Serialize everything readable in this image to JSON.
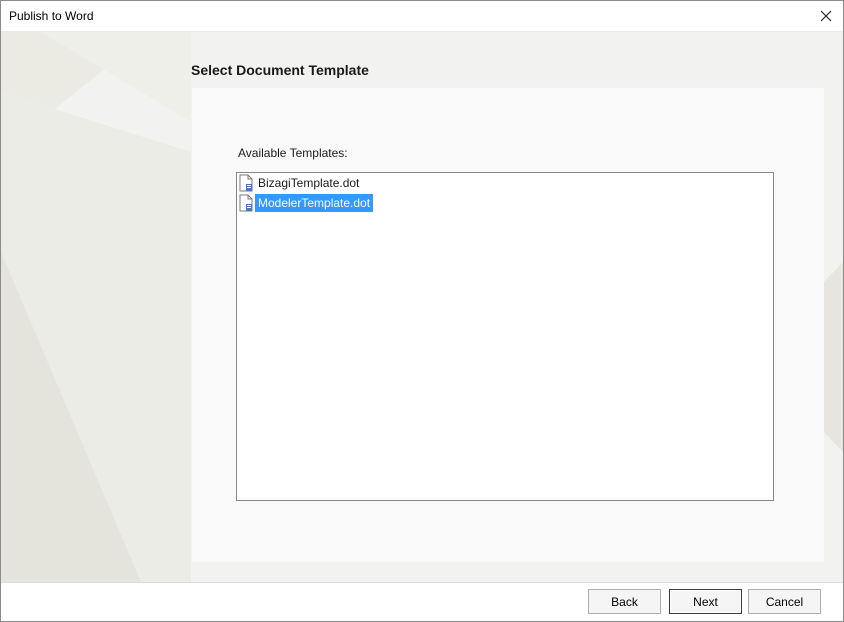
{
  "window": {
    "title": "Publish to Word"
  },
  "wizard": {
    "step_title": "Select Document Template",
    "available_label": "Available Templates:",
    "templates": [
      {
        "name": "BizagiTemplate.dot",
        "selected": false,
        "icon": "document-icon"
      },
      {
        "name": "ModelerTemplate.dot",
        "selected": true,
        "icon": "document-icon"
      }
    ]
  },
  "buttons": {
    "back": "Back",
    "next": "Next",
    "cancel": "Cancel"
  },
  "colors": {
    "selection": "#3399ff",
    "background": "#f2f2f0",
    "panel": "#f9f9f9"
  }
}
